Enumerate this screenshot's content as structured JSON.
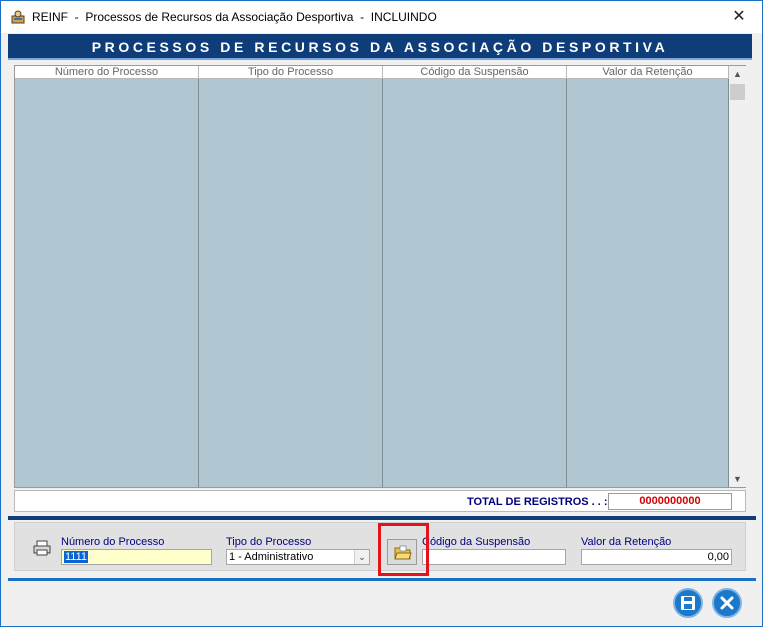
{
  "window": {
    "title": "REINF  -  Processos de Recursos da Associação Desportiva  -  INCLUINDO",
    "close_glyph": "✕"
  },
  "banner": {
    "title": "PROCESSOS DE RECURSOS DA ASSOCIAÇÃO DESPORTIVA"
  },
  "grid": {
    "columns": [
      "Número do Processo",
      "Tipo do Processo",
      "Código da Suspensão",
      "Valor da Retenção"
    ],
    "rows": [],
    "scroll_up_glyph": "▲",
    "scroll_down_glyph": "▼"
  },
  "totals": {
    "label": "TOTAL DE REGISTROS . . :",
    "value": "0000000000"
  },
  "form": {
    "numero_label": "Número do Processo",
    "numero_value": "1111",
    "tipo_label": "Tipo do Processo",
    "tipo_value": "1 - Administrativo",
    "codigo_label": "Código da Suspensão",
    "codigo_value": "",
    "valor_label": "Valor da Retenção",
    "valor_value": "0,00",
    "dropdown_glyph": "⌄"
  },
  "icons": {
    "app": "reinf-app-icon",
    "printer": "printer-icon",
    "folder": "open-folder-icon",
    "save": "save-disk-icon",
    "cancel": "close-x-icon"
  },
  "colors": {
    "banner": "#0e3d7a",
    "grid_body": "#b0c7d1",
    "total_value": "#d40000",
    "label": "#00007f",
    "highlight": "#e3131b",
    "round_button": "#1c78c8"
  }
}
